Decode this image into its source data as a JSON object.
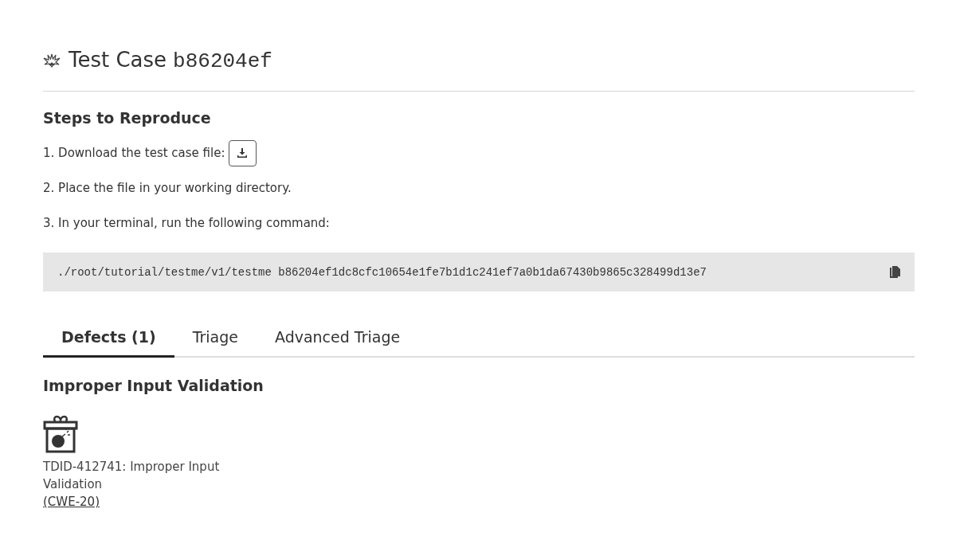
{
  "header": {
    "title": "Test Case",
    "hash": "b86204ef"
  },
  "steps": {
    "heading": "Steps to Reproduce",
    "items": [
      {
        "kind": "download",
        "text": "1. Download the test case file:"
      },
      {
        "kind": "text",
        "text": "2. Place the file in your working directory."
      },
      {
        "kind": "text",
        "text": "3. In your terminal, run the following command:"
      }
    ],
    "command": "./root/tutorial/testme/v1/testme b86204ef1dc8cfc10654e1fe7b1d1c241ef7a0b1da67430b9865c328499d13e7"
  },
  "tabs": [
    {
      "label": "Defects (1)",
      "selected": true
    },
    {
      "label": "Triage",
      "selected": false
    },
    {
      "label": "Advanced Triage",
      "selected": false
    }
  ],
  "defect": {
    "heading": "Improper Input Validation",
    "description": "TDID-412741: Improper Input Validation",
    "link": "(CWE-20)"
  }
}
